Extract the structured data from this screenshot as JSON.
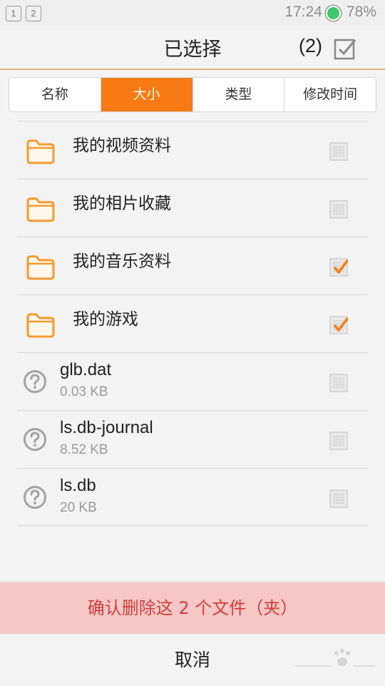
{
  "status_bar": {
    "notifications": [
      "1",
      "2"
    ],
    "time": "17:24",
    "battery": "78%"
  },
  "header": {
    "title": "已选择",
    "count": "(2)"
  },
  "sort_tabs": [
    {
      "label": "名称",
      "active": false
    },
    {
      "label": "大小",
      "active": true
    },
    {
      "label": "类型",
      "active": false
    },
    {
      "label": "修改时间",
      "active": false
    }
  ],
  "folders": [
    {
      "name": "我的视频资料",
      "checked": false
    },
    {
      "name": "我的相片收藏",
      "checked": false
    },
    {
      "name": "我的音乐资料",
      "checked": true
    },
    {
      "name": "我的游戏",
      "checked": true
    }
  ],
  "files": [
    {
      "name": "glb.dat",
      "size": "0.03 KB",
      "checked": false
    },
    {
      "name": "ls.db-journal",
      "size": "8.52 KB",
      "checked": false
    },
    {
      "name": "ls.db",
      "size": "20 KB",
      "checked": false
    }
  ],
  "actions": {
    "confirm_delete": "确认删除这 2 个文件（夹）",
    "cancel": "取消"
  },
  "colors": {
    "accent": "#f77b12",
    "folder": "#f39a2c",
    "delete_bg": "#f5c7c7",
    "delete_text": "#d0403a"
  }
}
